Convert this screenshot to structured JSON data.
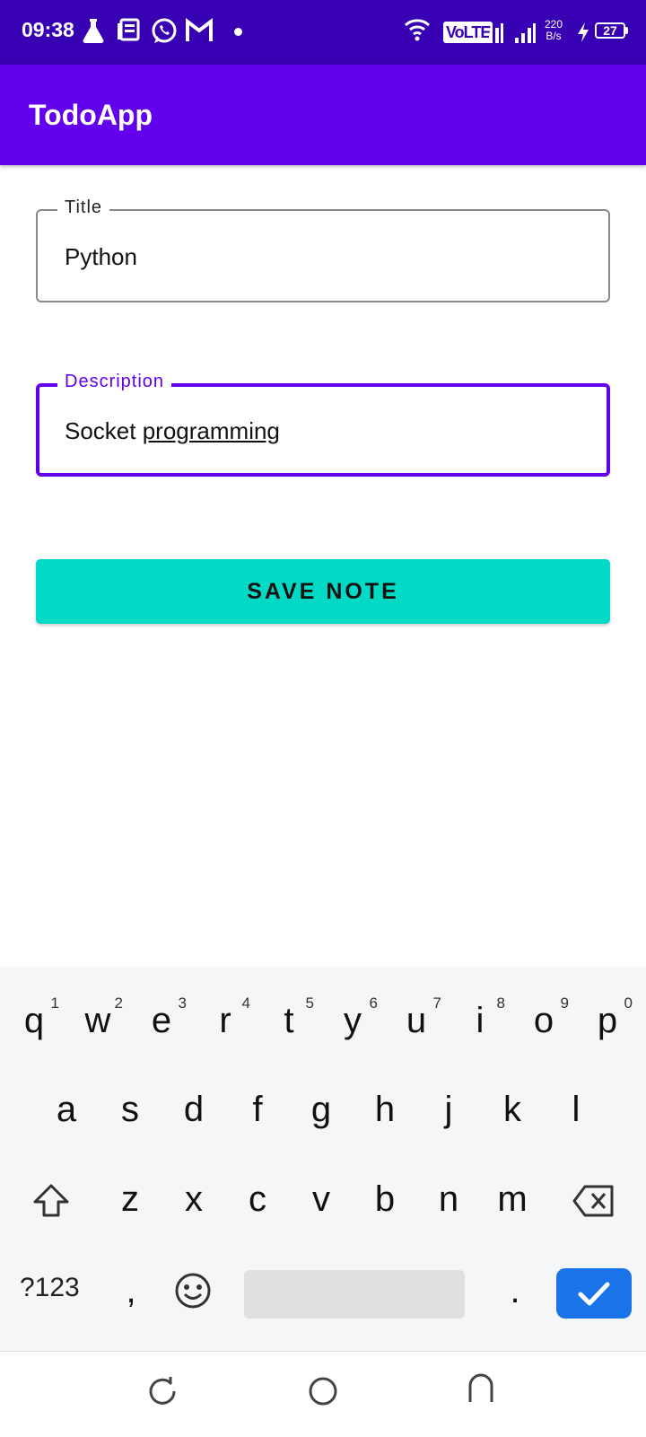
{
  "status_bar": {
    "time": "09:38",
    "network_type": "VoLTE",
    "speed_value": "220",
    "speed_unit": "B/s",
    "battery": "27",
    "icons": [
      "flask-icon",
      "news-icon",
      "whatsapp-icon",
      "gmail-icon",
      "dot-icon",
      "wifi-icon",
      "signal-icon",
      "signal-icon",
      "charging-icon",
      "battery-icon"
    ]
  },
  "app_bar": {
    "title": "TodoApp"
  },
  "form": {
    "title_label": "Title",
    "title_value": "Python",
    "description_label": "Description",
    "description_value_word1": "Socket ",
    "description_value_word2": "programming",
    "save_label": "SAVE NOTE"
  },
  "keyboard": {
    "row1": [
      "q",
      "w",
      "e",
      "r",
      "t",
      "y",
      "u",
      "i",
      "o",
      "p"
    ],
    "row1_hints": [
      "1",
      "2",
      "3",
      "4",
      "5",
      "6",
      "7",
      "8",
      "9",
      "0"
    ],
    "row2": [
      "a",
      "s",
      "d",
      "f",
      "g",
      "h",
      "j",
      "k",
      "l"
    ],
    "row3": [
      "z",
      "x",
      "c",
      "v",
      "b",
      "n",
      "m"
    ],
    "symbols_label": "?123",
    "comma": ",",
    "period": "."
  },
  "colors": {
    "status_bar": "#3700b3",
    "app_bar": "#6200ee",
    "focus": "#6200ee",
    "button": "#03dac5",
    "enter_key": "#1a73e8"
  }
}
